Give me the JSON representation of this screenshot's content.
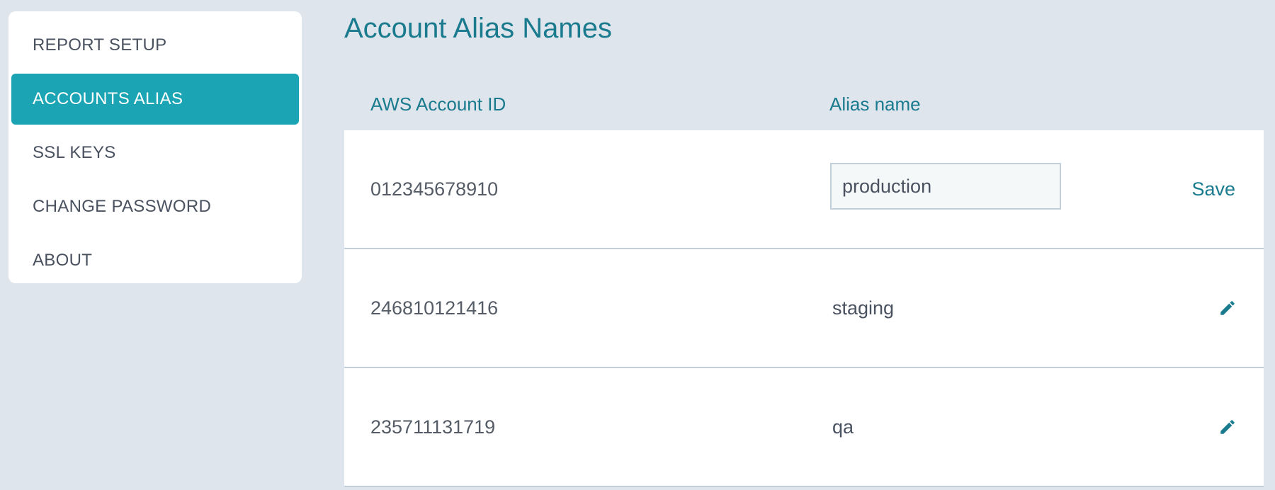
{
  "sidebar": {
    "items": [
      {
        "label": "REPORT SETUP",
        "active": false
      },
      {
        "label": "ACCOUNTS ALIAS",
        "active": true
      },
      {
        "label": "SSL KEYS",
        "active": false
      },
      {
        "label": "CHANGE PASSWORD",
        "active": false
      },
      {
        "label": "ABOUT",
        "active": false
      }
    ]
  },
  "main": {
    "title": "Account Alias Names",
    "columns": {
      "account_id": "AWS Account ID",
      "alias": "Alias name"
    },
    "rows": [
      {
        "account_id": "012345678910",
        "alias": "production",
        "editing": true,
        "action": "Save"
      },
      {
        "account_id": "246810121416",
        "alias": "staging",
        "editing": false,
        "action_icon": "pencil-icon"
      },
      {
        "account_id": "235711131719",
        "alias": "qa",
        "editing": false,
        "action_icon": "pencil-icon"
      }
    ]
  },
  "colors": {
    "accent": "#1aa4b4",
    "heading": "#1a7a8e",
    "background": "#dfe5ec"
  }
}
